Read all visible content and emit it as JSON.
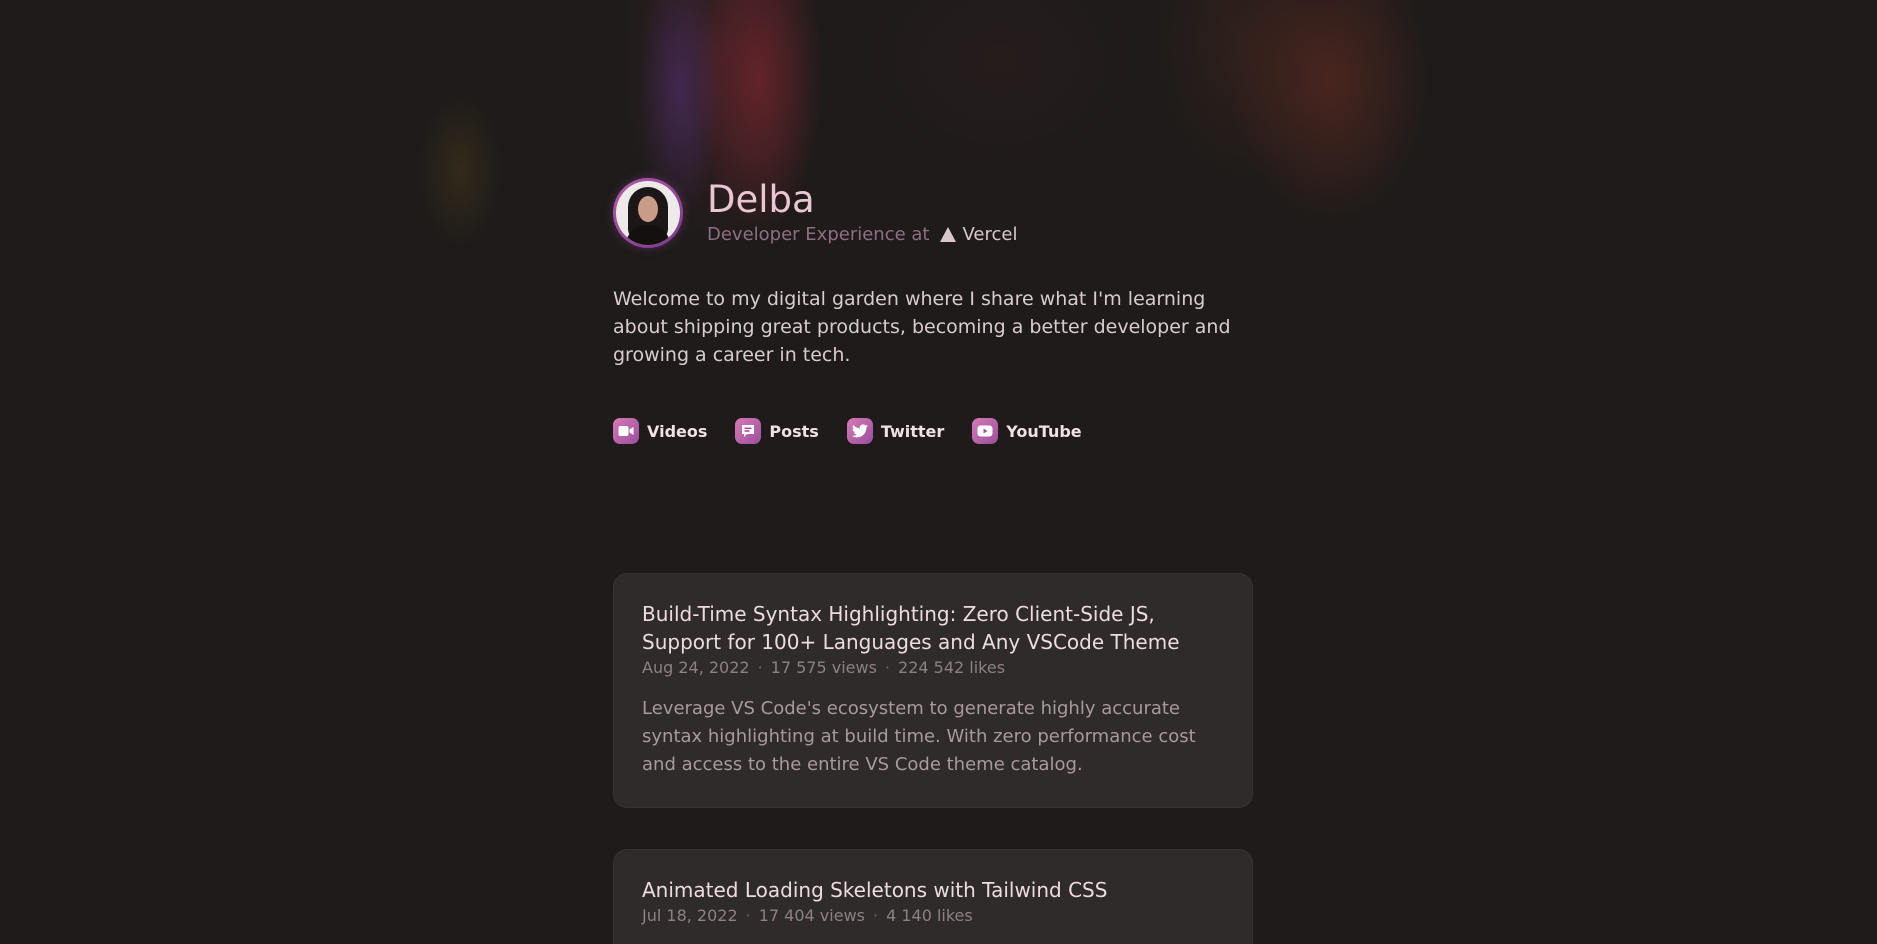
{
  "profile": {
    "name": "Delba",
    "role": "Developer Experience at",
    "company": "Vercel"
  },
  "intro": "Welcome to my digital garden where I share what I'm learning about shipping great products, becoming a better developer and growing a career in tech.",
  "links": [
    {
      "label": "Videos",
      "icon": "video-icon"
    },
    {
      "label": "Posts",
      "icon": "chat-icon"
    },
    {
      "label": "Twitter",
      "icon": "twitter-icon"
    },
    {
      "label": "YouTube",
      "icon": "youtube-icon"
    }
  ],
  "posts": [
    {
      "title": "Build-Time Syntax Highlighting: Zero Client-Side JS, Support for 100+ Languages and Any VSCode Theme",
      "date": "Aug 24, 2022",
      "views": "17 575 views",
      "likes": "224 542 likes",
      "description": "Leverage VS Code's ecosystem to generate highly accurate syntax highlighting at build time. With zero performance cost and access to the entire VS Code theme catalog."
    },
    {
      "title": "Animated Loading Skeletons with Tailwind CSS",
      "date": "Jul 18, 2022",
      "views": "17 404 views",
      "likes": "4 140 likes"
    }
  ],
  "meta_separator": "·",
  "colors": {
    "background": "#1e1b1a",
    "accent": "#c465a9",
    "name": "#e8c6d2",
    "role": "#8e6f82"
  }
}
